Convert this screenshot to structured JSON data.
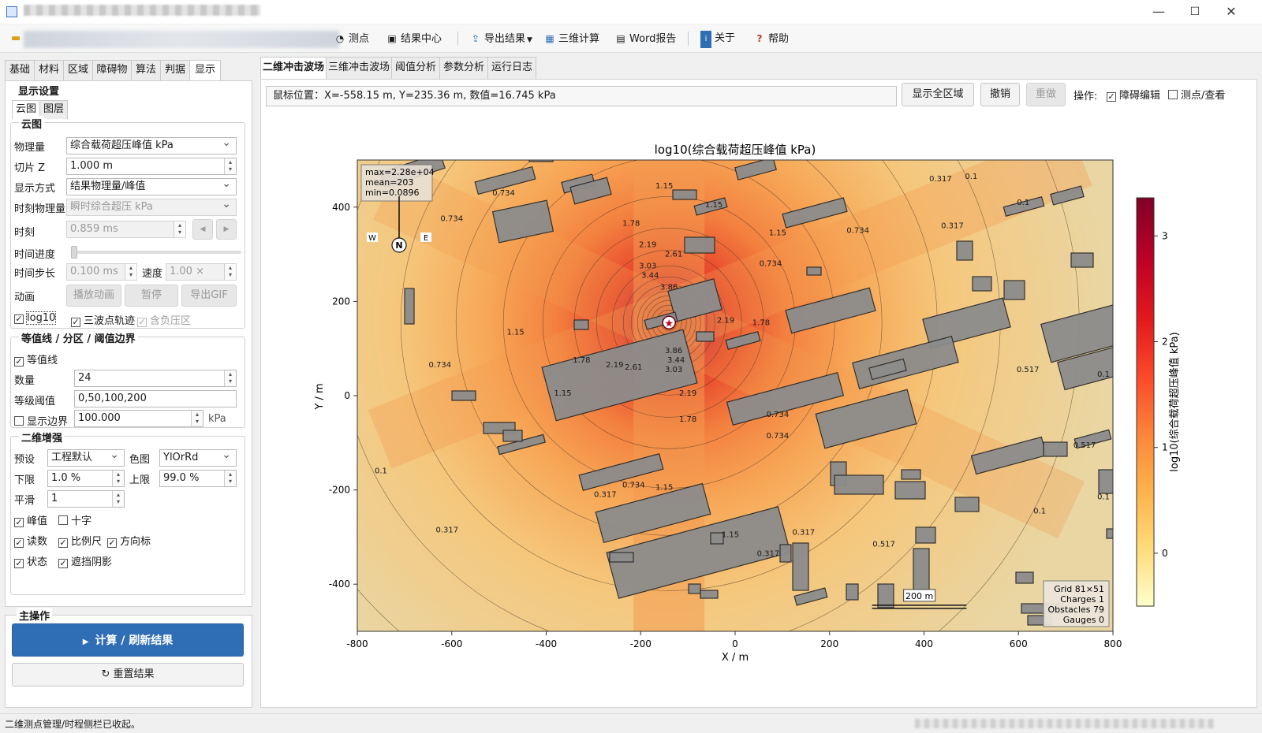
{
  "toolbar": {
    "items": [
      {
        "label": "测点",
        "icon": "gauge-icon"
      },
      {
        "label": "结果中心",
        "icon": "result-icon"
      },
      {
        "label": "导出结果",
        "icon": "export-icon"
      },
      {
        "label": "三维计算",
        "icon": "3d-icon"
      },
      {
        "label": "Word报告",
        "icon": "document-icon"
      },
      {
        "label": "关于",
        "icon": "info-icon"
      },
      {
        "label": "帮助",
        "icon": "help-icon"
      }
    ]
  },
  "left_tabs": [
    "基础",
    "材料",
    "区域",
    "障碍物",
    "算法",
    "判据",
    "显示"
  ],
  "display": {
    "title": "显示设置",
    "subtabs": [
      "云图",
      "图层"
    ],
    "cloud": {
      "title": "云图",
      "quantity_label": "物理量",
      "quantity_value": "综合载荷超压峰值 kPa",
      "slice_label": "切片 Z",
      "slice_value": "1.000 m",
      "mode_label": "显示方式",
      "mode_value": "结果物理量/峰值",
      "instant_label": "时刻物理量",
      "instant_value": "瞬时综合超压 kPa",
      "time_label": "时刻",
      "time_value": "0.859 ms",
      "progress_label": "时间进度",
      "step_label": "时间步长",
      "step_value": "0.100 ms",
      "speed_label": "速度",
      "speed_value": "1.00 ×",
      "anim_label": "动画",
      "play_label": "播放动画",
      "pause_label": "暂停",
      "gif_label": "导出GIF",
      "log10_label": "log10",
      "log10_checked": true,
      "tri_label": "三波点轨迹",
      "tri_checked": true,
      "neg_label": "含负压区",
      "neg_checked": true
    },
    "contour": {
      "title": "等值线 / 分区 / 阈值边界",
      "enable_label": "等值线",
      "enable_checked": true,
      "count_label": "数量",
      "count_value": "24",
      "levels_label": "等级阈值",
      "levels_value": "0,50,100,200",
      "boundary_label": "显示边界",
      "boundary_checked": false,
      "boundary_value": "100.000",
      "boundary_unit": "kPa"
    },
    "enhance": {
      "title": "二维增强",
      "preset_label": "预设",
      "preset_value": "工程默认",
      "cmap_label": "色图",
      "cmap_value": "YlOrRd",
      "low_label": "下限",
      "low_value": "1.0 %",
      "high_label": "上限",
      "high_value": "99.0 %",
      "smooth_label": "平滑",
      "smooth_value": "1",
      "checks": [
        {
          "label": "峰值",
          "checked": true
        },
        {
          "label": "十字",
          "checked": false
        },
        {
          "label": "读数",
          "checked": true
        },
        {
          "label": "比例尺",
          "checked": true
        },
        {
          "label": "方向标",
          "checked": true
        },
        {
          "label": "状态",
          "checked": true
        },
        {
          "label": "遮挡阴影",
          "checked": true
        }
      ]
    }
  },
  "main_ops": {
    "title": "主操作",
    "run_label": "计算 / 刷新结果",
    "reset_label": "重置结果"
  },
  "right_tabs": [
    "二维冲击波场",
    "三维冲击波场",
    "阈值分析",
    "参数分析",
    "运行日志"
  ],
  "plotbar": {
    "mouse": "鼠标位置：X=-558.15 m, Y=235.36 m, 数值=16.745 kPa",
    "show_all": "显示全区域",
    "undo": "撤销",
    "redo": "重做",
    "ops_label": "操作:",
    "obstacle_edit": "障碍编辑",
    "obstacle_checked": true,
    "gauge_view": "测点/查看",
    "gauge_checked": false
  },
  "colors": {
    "accent": "#2f6db5",
    "obstacle": "#8c8c8c"
  },
  "chart_data": {
    "type": "heatmap",
    "title": "log10(综合载荷超压峰值 kPa)",
    "xlabel": "X / m",
    "ylabel": "Y / m",
    "xlim": [
      -800,
      800
    ],
    "ylim": [
      -500,
      500
    ],
    "xticks": [
      -800,
      -600,
      -400,
      -200,
      0,
      200,
      400,
      600,
      800
    ],
    "yticks": [
      400,
      200,
      0,
      -200,
      -400
    ],
    "colorbar": {
      "label": "log10(综合载荷超压峰值 kPa)",
      "ticks": [
        3,
        2,
        1,
        0
      ],
      "range": [
        -0.5,
        3.36
      ],
      "colormap": "YlOrRd"
    },
    "charge": {
      "x": -140,
      "y": 155
    },
    "contour_labels": [
      {
        "text": "3.86",
        "x": -140,
        "y": 225
      },
      {
        "text": "3.44",
        "x": -180,
        "y": 250
      },
      {
        "text": "3.03",
        "x": -185,
        "y": 270
      },
      {
        "text": "2.61",
        "x": -130,
        "y": 295
      },
      {
        "text": "2.19",
        "x": -185,
        "y": 315
      },
      {
        "text": "1.78",
        "x": -220,
        "y": 360
      },
      {
        "text": "1.15",
        "x": -150,
        "y": 440
      },
      {
        "text": "1.15",
        "x": -45,
        "y": 400
      },
      {
        "text": "1.15",
        "x": 90,
        "y": 340
      },
      {
        "text": "0.734",
        "x": -490,
        "y": 425
      },
      {
        "text": "0.734",
        "x": -600,
        "y": 370
      },
      {
        "text": "0.734",
        "x": 75,
        "y": 275
      },
      {
        "text": "0.734",
        "x": 260,
        "y": 345
      },
      {
        "text": "0.317",
        "x": 435,
        "y": 455
      },
      {
        "text": "0.1",
        "x": 500,
        "y": 460
      },
      {
        "text": "0.1",
        "x": 610,
        "y": 405
      },
      {
        "text": "0.317",
        "x": 460,
        "y": 355
      },
      {
        "text": "2.19",
        "x": -20,
        "y": 155
      },
      {
        "text": "1.78",
        "x": 55,
        "y": 150
      },
      {
        "text": "3.86",
        "x": -130,
        "y": 90
      },
      {
        "text": "3.44",
        "x": -125,
        "y": 70
      },
      {
        "text": "3.03",
        "x": -130,
        "y": 50
      },
      {
        "text": "2.61",
        "x": -215,
        "y": 55
      },
      {
        "text": "2.19",
        "x": -255,
        "y": 60
      },
      {
        "text": "1.78",
        "x": -325,
        "y": 70
      },
      {
        "text": "2.19",
        "x": -100,
        "y": 0
      },
      {
        "text": "1.78",
        "x": -100,
        "y": -55
      },
      {
        "text": "1.15",
        "x": -365,
        "y": 0
      },
      {
        "text": "1.15",
        "x": -465,
        "y": 130
      },
      {
        "text": "0.734",
        "x": -625,
        "y": 60
      },
      {
        "text": "0.734",
        "x": 90,
        "y": -45
      },
      {
        "text": "0.734",
        "x": 90,
        "y": -90
      },
      {
        "text": "1.15",
        "x": -150,
        "y": -200
      },
      {
        "text": "0.317",
        "x": -275,
        "y": -215
      },
      {
        "text": "0.734",
        "x": -215,
        "y": -195
      },
      {
        "text": "0.317",
        "x": -610,
        "y": -290
      },
      {
        "text": "1.15",
        "x": -10,
        "y": -300
      },
      {
        "text": "0.317",
        "x": 145,
        "y": -295
      },
      {
        "text": "0.317",
        "x": 70,
        "y": -340
      },
      {
        "text": "0.517",
        "x": 315,
        "y": -320
      },
      {
        "text": "0.517",
        "x": 620,
        "y": 50
      },
      {
        "text": "0.517",
        "x": 740,
        "y": -110
      },
      {
        "text": "0.1",
        "x": -750,
        "y": -165
      },
      {
        "text": "0.1",
        "x": 780,
        "y": -220
      },
      {
        "text": "0.1",
        "x": 780,
        "y": 40
      },
      {
        "text": "0.1",
        "x": 645,
        "y": -250
      }
    ],
    "stats_box": [
      "max=2.28e+04",
      "mean=203",
      "min=0.0896"
    ],
    "info_box": [
      "Grid 81×51",
      "Charges 1",
      "Obstacles 79",
      "Gauges 0"
    ],
    "scale_bar": "200 m",
    "compass": {
      "n": "N",
      "w": "W",
      "e": "E"
    }
  }
}
